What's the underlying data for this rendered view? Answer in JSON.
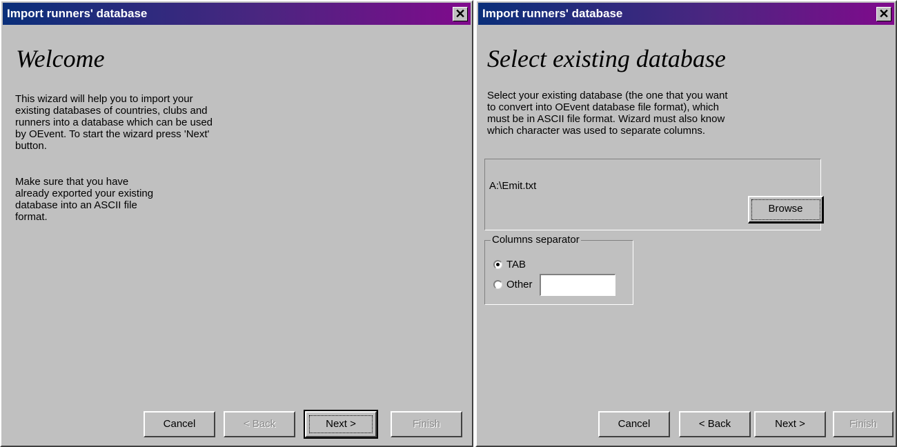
{
  "left_window": {
    "title": "Import runners' database",
    "close_glyph": "✕",
    "heading": "Welcome",
    "paragraph1": "This wizard will help you to import your existing databases of countries, clubs and runners into a database which can be used by OEvent. To start the wizard press 'Next' button.",
    "paragraph2": "Make sure that you have already exported your existing database into an ASCII file format.",
    "buttons": {
      "cancel": "Cancel",
      "back": "< Back",
      "next": "Next >",
      "finish": "Finish"
    }
  },
  "right_window": {
    "title": "Import runners' database",
    "close_glyph": "✕",
    "heading": "Select existing database",
    "paragraph": "Select your existing database (the one that you want to convert into OEvent database file format), which must be in ASCII file format. Wizard must also know which character was used to separate columns.",
    "file_path": "A:\\Emit.txt",
    "browse_label": "Browse",
    "separator_group": {
      "legend": "Columns separator",
      "option_tab": "TAB",
      "option_other": "Other",
      "other_value": "",
      "selected": "TAB"
    },
    "buttons": {
      "cancel": "Cancel",
      "back": "< Back",
      "next": "Next >",
      "finish": "Finish"
    }
  },
  "colors": {
    "window_bg": "#c0c0c0",
    "titlebar_start": "#0a2f7a",
    "titlebar_end": "#800a8c",
    "disabled_text": "#8a8a8a"
  },
  "icons": {
    "close": "close-icon",
    "radio": "radio-button"
  }
}
